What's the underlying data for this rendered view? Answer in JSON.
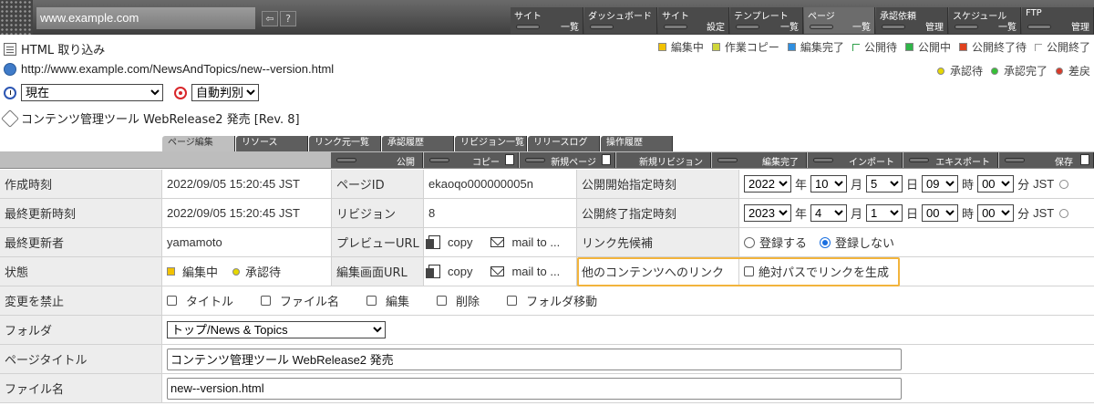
{
  "header": {
    "site_url": "www.example.com",
    "tabs": [
      {
        "top": "サイト",
        "bottom": "一覧"
      },
      {
        "top": "ダッシュボード",
        "bottom": ""
      },
      {
        "top": "サイト",
        "bottom": "設定"
      },
      {
        "top": "テンプレート",
        "bottom": "一覧"
      },
      {
        "top": "ページ",
        "bottom": "一覧"
      },
      {
        "top": "承認依頼",
        "bottom": "管理"
      },
      {
        "top": "スケジュール",
        "bottom": "一覧"
      },
      {
        "top": "FTP",
        "bottom": "管理"
      }
    ]
  },
  "info": {
    "import_title": "HTML 取り込み",
    "url": "http://www.example.com/NewsAndTopics/new--version.html",
    "time_select": "現在",
    "encoding_select": "自動判別",
    "content_title": "コンテンツ管理ツール WebRelease2 発売 [Rev. 8]"
  },
  "legend": {
    "status_items": [
      {
        "label": "編集中",
        "color": "#f2c200"
      },
      {
        "label": "作業コピー",
        "color": "#cfd63a"
      },
      {
        "label": "編集完了",
        "color": "#2f8fe0"
      },
      {
        "label": "公開待",
        "color": "#2fa04a"
      },
      {
        "label": "公開中",
        "color": "#2fb548"
      },
      {
        "label": "公開終了待",
        "color": "#e0421e"
      },
      {
        "label": "公開終了",
        "color": "#9a9a9a"
      }
    ],
    "approval_items": [
      {
        "label": "承認待",
        "color": "#e6d800"
      },
      {
        "label": "承認完了",
        "color": "#35c036"
      },
      {
        "label": "差戻",
        "color": "#d83a2a"
      }
    ]
  },
  "page_tabs": [
    "ページ編集",
    "リソース",
    "リンク元一覧",
    "承認履歴",
    "リビジョン一覧",
    "リリースログ",
    "操作履歴"
  ],
  "actions": [
    "公開",
    "コピー",
    "新規ページ",
    "新規リビジョン",
    "編集完了",
    "インポート",
    "エキスポート",
    "保存"
  ],
  "form": {
    "created_label": "作成時刻",
    "created_value": "2022/09/05 15:20:45 JST",
    "page_id_label": "ページID",
    "page_id_value": "ekaoqo000000005n",
    "publish_start_label": "公開開始指定時刻",
    "publish_start": {
      "year": "2022",
      "month": "10",
      "day": "5",
      "hour": "09",
      "minute": "00"
    },
    "updated_label": "最終更新時刻",
    "updated_value": "2022/09/05 15:20:45 JST",
    "revision_label": "リビジョン",
    "revision_value": "8",
    "publish_end_label": "公開終了指定時刻",
    "publish_end": {
      "year": "2023",
      "month": "4",
      "day": "1",
      "hour": "00",
      "minute": "00"
    },
    "unit_year": "年",
    "unit_month": "月",
    "unit_day": "日",
    "unit_hour": "時",
    "unit_minute": "分",
    "tz": "JST",
    "updater_label": "最終更新者",
    "updater_value": "yamamoto",
    "preview_url_label": "プレビューURL",
    "copy_label": "copy",
    "mailto_label": "mail to ...",
    "link_candidate_label": "リンク先候補",
    "radio_register": "登録する",
    "radio_no_register": "登録しない",
    "status_label": "状態",
    "status_editing": "編集中",
    "status_approval": "承認待",
    "edit_url_label": "編集画面URL",
    "link_other_label": "他のコンテンツへのリンク",
    "absolute_path_label": "絶対パスでリンクを生成",
    "lock_label": "変更を禁止",
    "lock_items": [
      "タイトル",
      "ファイル名",
      "編集",
      "削除",
      "フォルダ移動"
    ],
    "folder_label": "フォルダ",
    "folder_value": "トップ/News & Topics",
    "page_title_label": "ページタイトル",
    "page_title_value": "コンテンツ管理ツール WebRelease2 発売",
    "filename_label": "ファイル名",
    "filename_value": "new--version.html"
  }
}
